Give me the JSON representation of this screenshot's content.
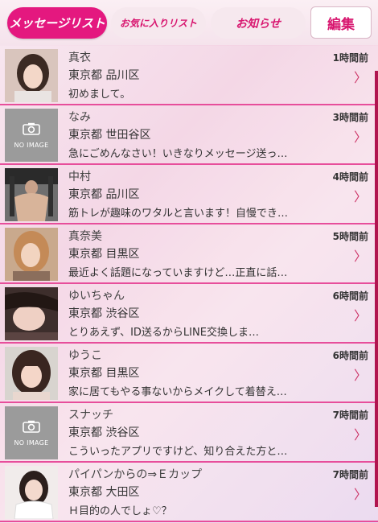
{
  "header": {
    "tabs": [
      {
        "label": "メッセージリスト",
        "active": true
      },
      {
        "label": "お気に入りリスト",
        "active": false
      },
      {
        "label": "お知らせ",
        "active": false
      }
    ],
    "edit_label": "編集"
  },
  "no_image_label": "NO IMAGE",
  "messages": [
    {
      "name": "真衣",
      "area": "東京都 品川区",
      "text": "初めまして。",
      "time": "1時間前",
      "avatar": "photo"
    },
    {
      "name": "なみ",
      "area": "東京都 世田谷区",
      "text": "急にごめんなさい！いきなりメッセージ送っ…",
      "time": "3時間前",
      "avatar": "no-image"
    },
    {
      "name": "中村",
      "area": "東京都 品川区",
      "text": "筋トレが趣味のワタルと言います！自慢でき…",
      "time": "4時間前",
      "avatar": "photo"
    },
    {
      "name": "真奈美",
      "area": "東京都 目黒区",
      "text": "最近よく話題になっていますけど…正直に話…",
      "time": "5時間前",
      "avatar": "photo"
    },
    {
      "name": "ゆいちゃん",
      "area": "東京都 渋谷区",
      "text": "とりあえず、ID送るからLINE交換しま…",
      "time": "6時間前",
      "avatar": "photo"
    },
    {
      "name": "ゆうこ",
      "area": "東京都 目黒区",
      "text": "家に居てもやる事ないからメイクして着替え…",
      "time": "6時間前",
      "avatar": "photo"
    },
    {
      "name": "スナッチ",
      "area": "東京都 渋谷区",
      "text": "こういったアプリですけど、知り合えた方と…",
      "time": "7時間前",
      "avatar": "no-image"
    },
    {
      "name": "パイパンからの⇒Ｅカップ",
      "area": "東京都 大田区",
      "text": "Ｈ目的の人でしょ♡？",
      "time": "7時間前",
      "avatar": "photo"
    }
  ],
  "colors": {
    "accent": "#e4187f",
    "divider": "#e74e9b"
  }
}
